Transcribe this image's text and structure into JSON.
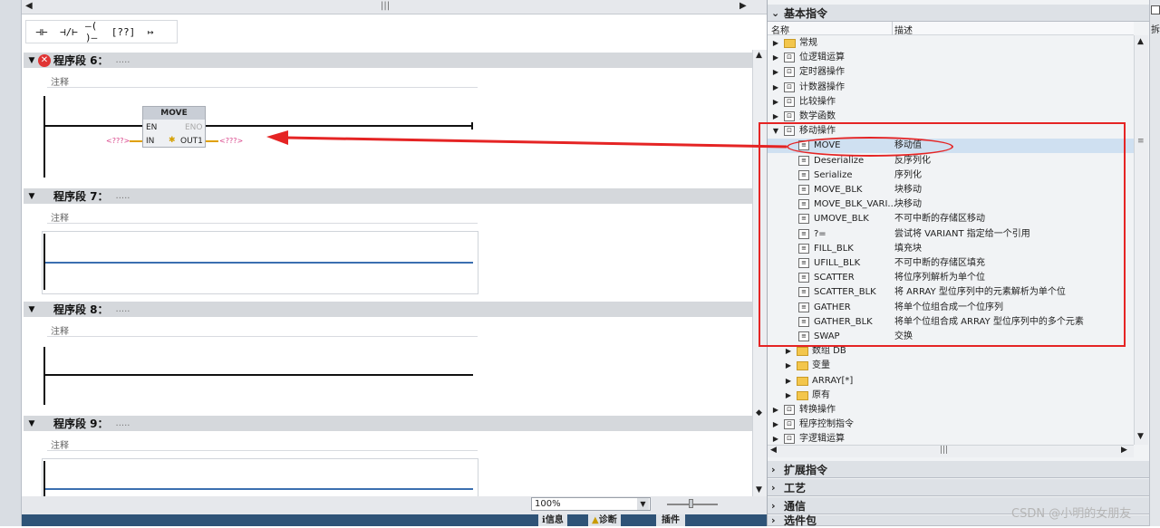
{
  "editor": {
    "toolbar": [
      "⊣⊢",
      "⊣/⊢",
      "–( )–",
      "[??]",
      "↦"
    ],
    "networks": [
      {
        "title": "程序段 6：",
        "dots": ".....",
        "comment": "注释",
        "error": true
      },
      {
        "title": "程序段 7：",
        "dots": ".....",
        "comment": "注释",
        "error": false
      },
      {
        "title": "程序段 8：",
        "dots": ".....",
        "comment": "注释",
        "error": false
      },
      {
        "title": "程序段 9：",
        "dots": ".....",
        "comment": "注释",
        "error": false
      }
    ],
    "move_block": {
      "title": "MOVE",
      "en": "EN",
      "eno": "ENO",
      "in": "IN",
      "out": "OUT1",
      "in_value": "<???>",
      "out_value": "<???>"
    },
    "zoom": "100%",
    "status_tabs": [
      "信息",
      "诊断",
      "插件"
    ]
  },
  "panel": {
    "sections": {
      "basic": "基本指令",
      "extended": "扩展指令",
      "tech": "工艺",
      "comm": "通信",
      "options": "选件包"
    },
    "columns": {
      "name": "名称",
      "desc": "描述"
    },
    "side_label": "拆",
    "tree": [
      {
        "label": "常规",
        "desc": "",
        "kind": "folder",
        "level": 0
      },
      {
        "label": "位逻辑运算",
        "desc": "",
        "kind": "cat",
        "level": 0
      },
      {
        "label": "定时器操作",
        "desc": "",
        "kind": "cat",
        "level": 0
      },
      {
        "label": "计数器操作",
        "desc": "",
        "kind": "cat",
        "level": 0
      },
      {
        "label": "比较操作",
        "desc": "",
        "kind": "cat",
        "level": 0
      },
      {
        "label": "数学函数",
        "desc": "",
        "kind": "cat",
        "level": 0
      },
      {
        "label": "移动操作",
        "desc": "",
        "kind": "cat",
        "level": 0,
        "open": true
      },
      {
        "label": "MOVE",
        "desc": "移动值",
        "kind": "instr",
        "level": 1,
        "selected": true
      },
      {
        "label": "Deserialize",
        "desc": "反序列化",
        "kind": "instr",
        "level": 1
      },
      {
        "label": "Serialize",
        "desc": "序列化",
        "kind": "instr",
        "level": 1
      },
      {
        "label": "MOVE_BLK",
        "desc": "块移动",
        "kind": "instr",
        "level": 1
      },
      {
        "label": "MOVE_BLK_VARI...",
        "desc": "块移动",
        "kind": "instr",
        "level": 1
      },
      {
        "label": "UMOVE_BLK",
        "desc": "不可中断的存储区移动",
        "kind": "instr",
        "level": 1
      },
      {
        "label": "?=",
        "desc": "尝试将 VARIANT 指定给一个引用",
        "kind": "instr",
        "level": 1
      },
      {
        "label": "FILL_BLK",
        "desc": "填充块",
        "kind": "instr",
        "level": 1
      },
      {
        "label": "UFILL_BLK",
        "desc": "不可中断的存储区填充",
        "kind": "instr",
        "level": 1
      },
      {
        "label": "SCATTER",
        "desc": "将位序列解析为单个位",
        "kind": "instr",
        "level": 1
      },
      {
        "label": "SCATTER_BLK",
        "desc": "将 ARRAY 型位序列中的元素解析为单个位",
        "kind": "instr",
        "level": 1
      },
      {
        "label": "GATHER",
        "desc": "将单个位组合成一个位序列",
        "kind": "instr",
        "level": 1
      },
      {
        "label": "GATHER_BLK",
        "desc": "将单个位组合成 ARRAY 型位序列中的多个元素",
        "kind": "instr",
        "level": 1
      },
      {
        "label": "SWAP",
        "desc": "交换",
        "kind": "instr",
        "level": 1
      },
      {
        "label": "数组 DB",
        "desc": "",
        "kind": "folder",
        "level": 1,
        "arrow": true
      },
      {
        "label": "变量",
        "desc": "",
        "kind": "folder",
        "level": 1,
        "arrow": true
      },
      {
        "label": "ARRAY[*]",
        "desc": "",
        "kind": "folder",
        "level": 1,
        "arrow": true
      },
      {
        "label": "原有",
        "desc": "",
        "kind": "folder",
        "level": 1,
        "arrow": true
      },
      {
        "label": "转换操作",
        "desc": "",
        "kind": "cat",
        "level": 0
      },
      {
        "label": "程序控制指令",
        "desc": "",
        "kind": "cat",
        "level": 0
      },
      {
        "label": "字逻辑运算",
        "desc": "",
        "kind": "cat",
        "level": 0
      }
    ]
  },
  "watermark": "CSDN @小明的女朋友",
  "colors": {
    "highlight": "#e52424",
    "selected": "#cfe0f1",
    "header": "#d5d8dc"
  }
}
